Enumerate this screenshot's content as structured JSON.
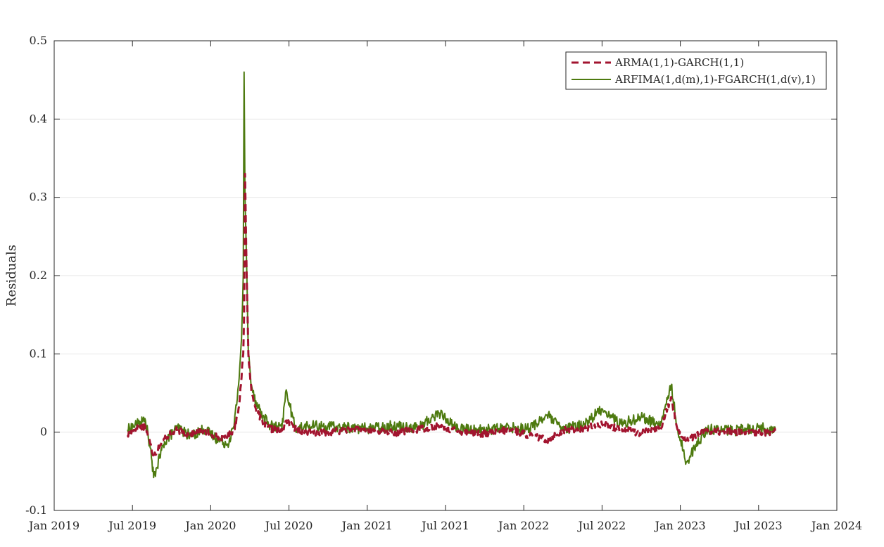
{
  "chart_data": {
    "type": "line",
    "title": "",
    "xlabel": "",
    "ylabel": "Residuals",
    "xlim": [
      "2019-01",
      "2024-01"
    ],
    "ylim": [
      -0.1,
      0.5
    ],
    "grid": "horizontal",
    "legend_position": "top-right",
    "x_ticks": [
      "Jan 2019",
      "Jul 2019",
      "Jan 2020",
      "Jul 2020",
      "Jan 2021",
      "Jul 2021",
      "Jan 2022",
      "Jul 2022",
      "Jan 2023",
      "Jul 2023",
      "Jan 2024"
    ],
    "y_ticks": [
      "-0.1",
      "0",
      "0.1",
      "0.2",
      "0.3",
      "0.4",
      "0.5"
    ],
    "series": [
      {
        "name": "ARMA(1,1)-GARCH(1,1)",
        "color": "#a2142f",
        "style": "dashed",
        "x": [
          "2019-06-20",
          "2019-07-10",
          "2019-08-01",
          "2019-08-12",
          "2019-08-20",
          "2019-09-15",
          "2019-10-15",
          "2019-11-15",
          "2019-12-15",
          "2020-01-15",
          "2020-02-10",
          "2020-02-25",
          "2020-03-05",
          "2020-03-12",
          "2020-03-16",
          "2020-03-18",
          "2020-03-20",
          "2020-03-24",
          "2020-03-28",
          "2020-04-05",
          "2020-04-15",
          "2020-05-01",
          "2020-05-20",
          "2020-06-15",
          "2020-06-25",
          "2020-07-15",
          "2020-09-01",
          "2020-11-01",
          "2021-01-01",
          "2021-03-01",
          "2021-05-01",
          "2021-06-15",
          "2021-08-01",
          "2021-10-01",
          "2021-12-01",
          "2022-01-15",
          "2022-02-25",
          "2022-04-01",
          "2022-05-20",
          "2022-07-01",
          "2022-08-15",
          "2022-10-01",
          "2022-11-15",
          "2022-12-10",
          "2022-12-25",
          "2023-01-15",
          "2023-03-01",
          "2023-05-01",
          "2023-07-01",
          "2023-08-10"
        ],
        "values": [
          -0.004,
          0.005,
          0.008,
          -0.015,
          -0.03,
          -0.008,
          0.003,
          -0.004,
          0.002,
          -0.006,
          -0.006,
          0.004,
          0.03,
          0.07,
          0.1,
          0.15,
          0.33,
          0.2,
          0.1,
          0.05,
          0.03,
          0.01,
          0.004,
          0.002,
          0.015,
          0.004,
          -0.002,
          0.002,
          0.003,
          -0.001,
          0.004,
          0.008,
          0.001,
          -0.002,
          0.003,
          -0.004,
          -0.01,
          0.002,
          0.005,
          0.01,
          0.004,
          -0.001,
          0.004,
          0.045,
          0.003,
          -0.01,
          0.001,
          0.001,
          -0.001,
          0.0
        ]
      },
      {
        "name": "ARFIMA(1,d(m),1)-FGARCH(1,d(v),1)",
        "color": "#4d7a0f",
        "style": "solid",
        "x": [
          "2019-06-20",
          "2019-07-10",
          "2019-08-01",
          "2019-08-12",
          "2019-08-20",
          "2019-09-15",
          "2019-10-15",
          "2019-11-15",
          "2019-12-15",
          "2020-01-15",
          "2020-02-10",
          "2020-02-25",
          "2020-03-05",
          "2020-03-12",
          "2020-03-16",
          "2020-03-18",
          "2020-03-20",
          "2020-03-24",
          "2020-03-28",
          "2020-04-05",
          "2020-04-15",
          "2020-05-01",
          "2020-05-20",
          "2020-06-15",
          "2020-06-25",
          "2020-07-15",
          "2020-09-01",
          "2020-11-01",
          "2021-01-01",
          "2021-03-01",
          "2021-05-01",
          "2021-06-15",
          "2021-08-01",
          "2021-10-01",
          "2021-12-01",
          "2022-01-15",
          "2022-02-25",
          "2022-04-01",
          "2022-05-20",
          "2022-07-01",
          "2022-08-15",
          "2022-10-01",
          "2022-11-15",
          "2022-12-10",
          "2022-12-25",
          "2023-01-15",
          "2023-03-01",
          "2023-05-01",
          "2023-07-01",
          "2023-08-10"
        ],
        "values": [
          0.003,
          0.01,
          0.015,
          -0.02,
          -0.058,
          -0.012,
          0.006,
          -0.005,
          0.004,
          -0.008,
          -0.015,
          0.008,
          0.06,
          0.12,
          0.2,
          0.46,
          0.3,
          0.21,
          0.1,
          0.06,
          0.04,
          0.02,
          0.008,
          0.005,
          0.054,
          0.005,
          0.008,
          0.006,
          0.005,
          0.008,
          0.006,
          0.025,
          0.004,
          0.003,
          0.006,
          0.005,
          0.022,
          0.003,
          0.01,
          0.03,
          0.01,
          0.02,
          0.008,
          0.06,
          0.004,
          -0.038,
          0.004,
          0.002,
          0.006,
          0.002
        ]
      }
    ]
  }
}
